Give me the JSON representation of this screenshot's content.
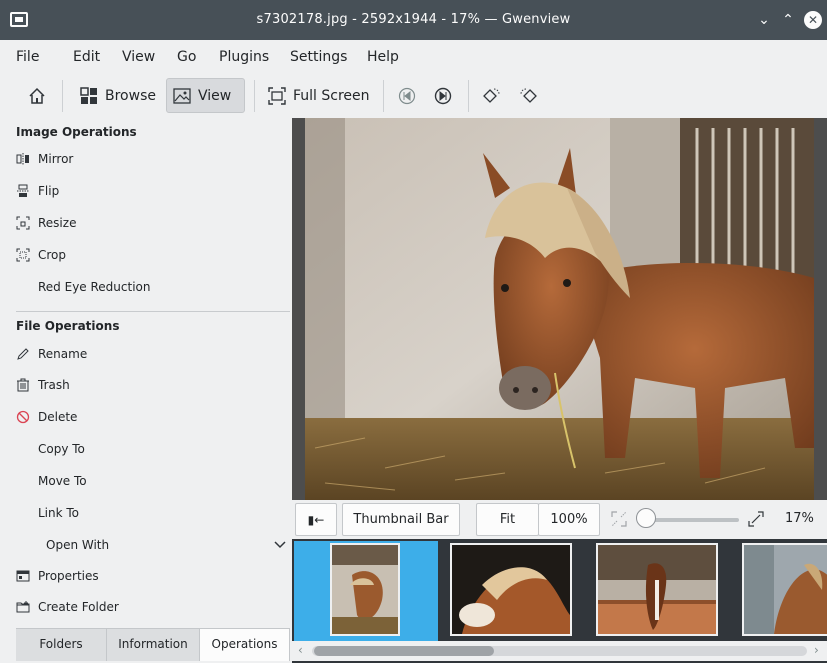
{
  "window": {
    "title": "s7302178.jpg - 2592x1944 - 17% — Gwenview",
    "min_glyph": "⌄",
    "max_glyph": "⌃",
    "close_glyph": "✕"
  },
  "menubar": {
    "items": [
      "File",
      "Edit",
      "View",
      "Go",
      "Plugins",
      "Settings",
      "Help"
    ]
  },
  "toolbar": {
    "home_icon": "home-icon",
    "browse_label": "Browse",
    "view_label": "View",
    "fullscreen_label": "Full Screen"
  },
  "sidebar": {
    "image_ops": {
      "title": "Image Operations",
      "items": [
        "Mirror",
        "Flip",
        "Resize",
        "Crop",
        "Red Eye Reduction"
      ]
    },
    "file_ops": {
      "title": "File Operations",
      "items": [
        "Rename",
        "Trash",
        "Delete",
        "Copy To",
        "Move To",
        "Link To",
        "Open With",
        "Properties",
        "Create Folder"
      ]
    },
    "tabs": [
      "Folders",
      "Information",
      "Operations"
    ],
    "active_tab": "Operations"
  },
  "statusbar": {
    "toggle_glyph": "▮←",
    "thumbnail_bar_label": "Thumbnail Bar",
    "fit_label": "Fit",
    "zoom100_label": "100%",
    "zoom_value": "17%",
    "zoom_level": 0.17
  },
  "colors": {
    "titlebar": "#475057",
    "selection": "#3daee9",
    "thumbbar_bg": "#31363b",
    "delete_icon": "#da4453"
  }
}
